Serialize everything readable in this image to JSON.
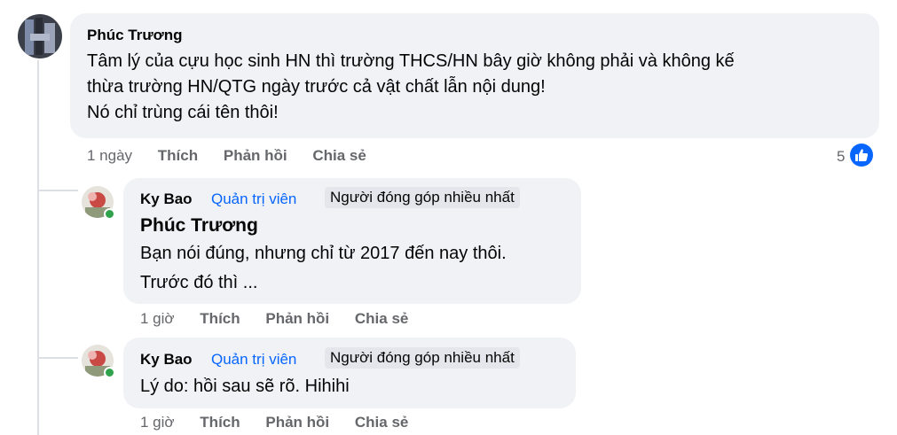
{
  "comment": {
    "author": "Phúc Trương",
    "lines": [
      "Tâm lý của cựu học sinh HN thì trường THCS/HN bây giờ không phải và không kế",
      "thừa trường HN/QTG ngày trước cả vật chất lẫn nội dung!",
      "Nó chỉ trùng cái tên thôi!"
    ],
    "time": "1 ngày",
    "like_label": "Thích",
    "reply_label": "Phản hồi",
    "share_label": "Chia sẻ",
    "reaction_count": "5",
    "reaction_icon": "like-icon",
    "colors": {
      "like_blue": "#0866ff",
      "admin_blue": "#0866ff",
      "online_green": "#31a24c",
      "bubble": "#f0f2f5"
    }
  },
  "replies": [
    {
      "author": "Ky Bao",
      "badge_admin": "Quản trị viên",
      "badge_top": "Người đóng góp nhiều nhất",
      "mention": "Phúc Trương",
      "lines": [
        "Bạn nói đúng, nhưng chỉ từ 2017 đến nay thôi.",
        "Trước đó thì ..."
      ],
      "time": "1 giờ",
      "like_label": "Thích",
      "reply_label": "Phản hồi",
      "share_label": "Chia sẻ"
    },
    {
      "author": "Ky Bao",
      "badge_admin": "Quản trị viên",
      "badge_top": "Người đóng góp nhiều nhất",
      "lines": [
        "Lý do: hồi sau sẽ rõ. Hihihi"
      ],
      "time": "1 giờ",
      "like_label": "Thích",
      "reply_label": "Phản hồi",
      "share_label": "Chia sẻ"
    }
  ]
}
